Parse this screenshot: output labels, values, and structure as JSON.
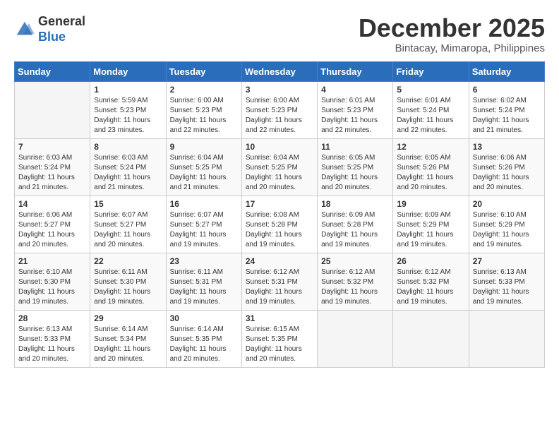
{
  "header": {
    "logo_general": "General",
    "logo_blue": "Blue",
    "month_title": "December 2025",
    "location": "Bintacay, Mimaropa, Philippines"
  },
  "calendar": {
    "days_of_week": [
      "Sunday",
      "Monday",
      "Tuesday",
      "Wednesday",
      "Thursday",
      "Friday",
      "Saturday"
    ],
    "weeks": [
      [
        {
          "day": "",
          "info": ""
        },
        {
          "day": "1",
          "info": "Sunrise: 5:59 AM\nSunset: 5:23 PM\nDaylight: 11 hours\nand 23 minutes."
        },
        {
          "day": "2",
          "info": "Sunrise: 6:00 AM\nSunset: 5:23 PM\nDaylight: 11 hours\nand 22 minutes."
        },
        {
          "day": "3",
          "info": "Sunrise: 6:00 AM\nSunset: 5:23 PM\nDaylight: 11 hours\nand 22 minutes."
        },
        {
          "day": "4",
          "info": "Sunrise: 6:01 AM\nSunset: 5:23 PM\nDaylight: 11 hours\nand 22 minutes."
        },
        {
          "day": "5",
          "info": "Sunrise: 6:01 AM\nSunset: 5:24 PM\nDaylight: 11 hours\nand 22 minutes."
        },
        {
          "day": "6",
          "info": "Sunrise: 6:02 AM\nSunset: 5:24 PM\nDaylight: 11 hours\nand 21 minutes."
        }
      ],
      [
        {
          "day": "7",
          "info": "Sunrise: 6:03 AM\nSunset: 5:24 PM\nDaylight: 11 hours\nand 21 minutes."
        },
        {
          "day": "8",
          "info": "Sunrise: 6:03 AM\nSunset: 5:24 PM\nDaylight: 11 hours\nand 21 minutes."
        },
        {
          "day": "9",
          "info": "Sunrise: 6:04 AM\nSunset: 5:25 PM\nDaylight: 11 hours\nand 21 minutes."
        },
        {
          "day": "10",
          "info": "Sunrise: 6:04 AM\nSunset: 5:25 PM\nDaylight: 11 hours\nand 20 minutes."
        },
        {
          "day": "11",
          "info": "Sunrise: 6:05 AM\nSunset: 5:25 PM\nDaylight: 11 hours\nand 20 minutes."
        },
        {
          "day": "12",
          "info": "Sunrise: 6:05 AM\nSunset: 5:26 PM\nDaylight: 11 hours\nand 20 minutes."
        },
        {
          "day": "13",
          "info": "Sunrise: 6:06 AM\nSunset: 5:26 PM\nDaylight: 11 hours\nand 20 minutes."
        }
      ],
      [
        {
          "day": "14",
          "info": "Sunrise: 6:06 AM\nSunset: 5:27 PM\nDaylight: 11 hours\nand 20 minutes."
        },
        {
          "day": "15",
          "info": "Sunrise: 6:07 AM\nSunset: 5:27 PM\nDaylight: 11 hours\nand 20 minutes."
        },
        {
          "day": "16",
          "info": "Sunrise: 6:07 AM\nSunset: 5:27 PM\nDaylight: 11 hours\nand 19 minutes."
        },
        {
          "day": "17",
          "info": "Sunrise: 6:08 AM\nSunset: 5:28 PM\nDaylight: 11 hours\nand 19 minutes."
        },
        {
          "day": "18",
          "info": "Sunrise: 6:09 AM\nSunset: 5:28 PM\nDaylight: 11 hours\nand 19 minutes."
        },
        {
          "day": "19",
          "info": "Sunrise: 6:09 AM\nSunset: 5:29 PM\nDaylight: 11 hours\nand 19 minutes."
        },
        {
          "day": "20",
          "info": "Sunrise: 6:10 AM\nSunset: 5:29 PM\nDaylight: 11 hours\nand 19 minutes."
        }
      ],
      [
        {
          "day": "21",
          "info": "Sunrise: 6:10 AM\nSunset: 5:30 PM\nDaylight: 11 hours\nand 19 minutes."
        },
        {
          "day": "22",
          "info": "Sunrise: 6:11 AM\nSunset: 5:30 PM\nDaylight: 11 hours\nand 19 minutes."
        },
        {
          "day": "23",
          "info": "Sunrise: 6:11 AM\nSunset: 5:31 PM\nDaylight: 11 hours\nand 19 minutes."
        },
        {
          "day": "24",
          "info": "Sunrise: 6:12 AM\nSunset: 5:31 PM\nDaylight: 11 hours\nand 19 minutes."
        },
        {
          "day": "25",
          "info": "Sunrise: 6:12 AM\nSunset: 5:32 PM\nDaylight: 11 hours\nand 19 minutes."
        },
        {
          "day": "26",
          "info": "Sunrise: 6:12 AM\nSunset: 5:32 PM\nDaylight: 11 hours\nand 19 minutes."
        },
        {
          "day": "27",
          "info": "Sunrise: 6:13 AM\nSunset: 5:33 PM\nDaylight: 11 hours\nand 19 minutes."
        }
      ],
      [
        {
          "day": "28",
          "info": "Sunrise: 6:13 AM\nSunset: 5:33 PM\nDaylight: 11 hours\nand 20 minutes."
        },
        {
          "day": "29",
          "info": "Sunrise: 6:14 AM\nSunset: 5:34 PM\nDaylight: 11 hours\nand 20 minutes."
        },
        {
          "day": "30",
          "info": "Sunrise: 6:14 AM\nSunset: 5:35 PM\nDaylight: 11 hours\nand 20 minutes."
        },
        {
          "day": "31",
          "info": "Sunrise: 6:15 AM\nSunset: 5:35 PM\nDaylight: 11 hours\nand 20 minutes."
        },
        {
          "day": "",
          "info": ""
        },
        {
          "day": "",
          "info": ""
        },
        {
          "day": "",
          "info": ""
        }
      ]
    ]
  }
}
